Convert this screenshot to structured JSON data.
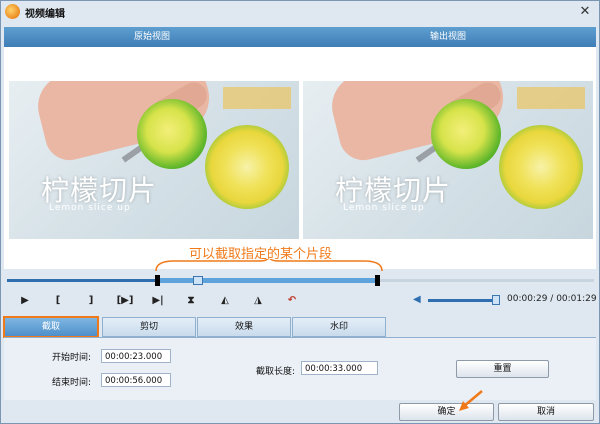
{
  "window": {
    "title": "视频编辑",
    "close_label": "✕"
  },
  "panes": {
    "original_label": "原始视图",
    "output_label": "输出视图"
  },
  "video": {
    "overlay_title": "柠檬切片",
    "overlay_subtitle": "Lemon slice up"
  },
  "annotation": "可以截取指定的某个片段",
  "timeline": {
    "progress": 0.32,
    "selection_start": 0.255,
    "selection_end": 0.63,
    "playhead": 0.325
  },
  "controls": {
    "play": "▶",
    "mark_in": "[",
    "mark_out": "]",
    "play_selection": "[▶]",
    "prev": "▶|",
    "flip_v": "⧗",
    "rotate_left": "◭",
    "rotate_right": "◮",
    "undo": "↶"
  },
  "volume": {
    "level": 1.0,
    "icon": "speaker-icon"
  },
  "time": {
    "current": "00:00:29",
    "total": "00:01:29",
    "separator": " / "
  },
  "tabs": [
    {
      "label": "截取",
      "active": true
    },
    {
      "label": "剪切",
      "active": false
    },
    {
      "label": "效果",
      "active": false
    },
    {
      "label": "水印",
      "active": false
    }
  ],
  "trim": {
    "start_label": "开始时间:",
    "start_value": "00:00:23.000",
    "end_label": "结束时间:",
    "end_value": "00:00:56.000",
    "length_label": "截取长度:",
    "length_value": "00:00:33.000",
    "reset_label": "重置"
  },
  "footer": {
    "ok_label": "确定",
    "cancel_label": "取消"
  },
  "colors": {
    "accent": "#f07a1a",
    "header": "#3f7db6",
    "track": "#2f6fb0"
  }
}
